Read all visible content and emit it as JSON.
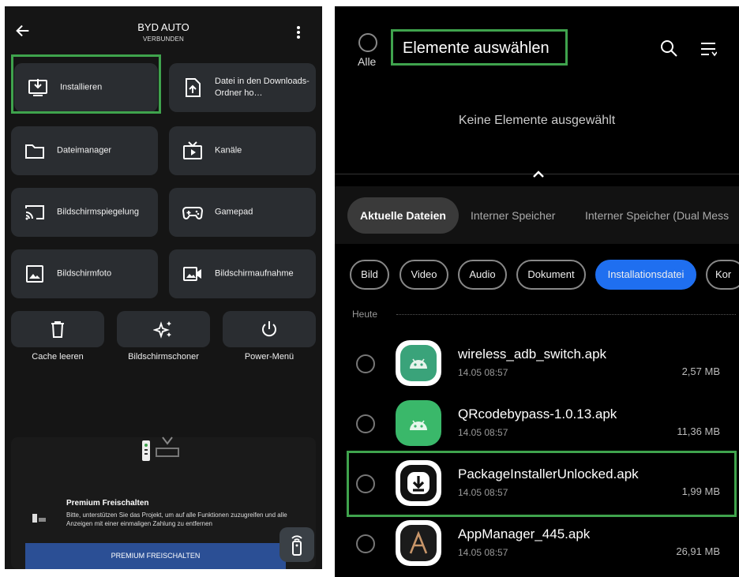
{
  "left": {
    "header": {
      "device_name": "BYD AUTO",
      "status": "VERBUNDEN"
    },
    "tiles": [
      {
        "label": "Installieren",
        "icon": "install-icon"
      },
      {
        "label": "Datei in den Downloads-Ordner ho…",
        "icon": "upload-file-icon"
      },
      {
        "label": "Dateimanager",
        "icon": "folder-icon"
      },
      {
        "label": "Kanäle",
        "icon": "tv-channels-icon"
      },
      {
        "label": "Bildschirmspiegelung",
        "icon": "cast-icon"
      },
      {
        "label": "Gamepad",
        "icon": "gamepad-icon"
      },
      {
        "label": "Bildschirmfoto",
        "icon": "screenshot-icon"
      },
      {
        "label": "Bildschirmaufnahme",
        "icon": "video-record-icon"
      }
    ],
    "small_tiles": [
      {
        "label": "Cache leeren",
        "icon": "trash-icon"
      },
      {
        "label": "Bildschirmschoner",
        "icon": "sparkle-icon"
      },
      {
        "label": "Power-Menü",
        "icon": "power-icon"
      }
    ],
    "promo": {
      "title": "Premium Freischalten",
      "text": "Bitte, unterstützen Sie das Projekt, um auf alle Funktionen zuzugreifen und alle Anzeigen mit einer einmaligen Zahlung zu entfernen",
      "button": "PREMIUM FREISCHALTEN"
    }
  },
  "right": {
    "select_all_label": "Alle",
    "title": "Elemente auswählen",
    "empty_text": "Keine Elemente ausgewählt",
    "tabs": [
      "Aktuelle Dateien",
      "Interner Speicher",
      "Interner Speicher (Dual Mess"
    ],
    "chips": [
      "Bild",
      "Video",
      "Audio",
      "Dokument",
      "Installationsdatei",
      "Kor"
    ],
    "section_label": "Heute",
    "files": [
      {
        "name": "wireless_adb_switch.apk",
        "date": "14.05 08:57",
        "size": "2,57 MB",
        "icon_color": "#3aa37a"
      },
      {
        "name": "QRcodebypass-1.0.13.apk",
        "date": "14.05 08:57",
        "size": "11,36 MB",
        "icon_color": "#3ab86a"
      },
      {
        "name": "PackageInstallerUnlocked.apk",
        "date": "14.05 08:57",
        "size": "1,99 MB",
        "icon_color": "#111111"
      },
      {
        "name": "AppManager_445.apk",
        "date": "14.05 08:57",
        "size": "26,91 MB",
        "icon_color": "#1b1b1b"
      }
    ],
    "highlight_color": "#3fa34d",
    "accent_color": "#1f6ff0"
  }
}
